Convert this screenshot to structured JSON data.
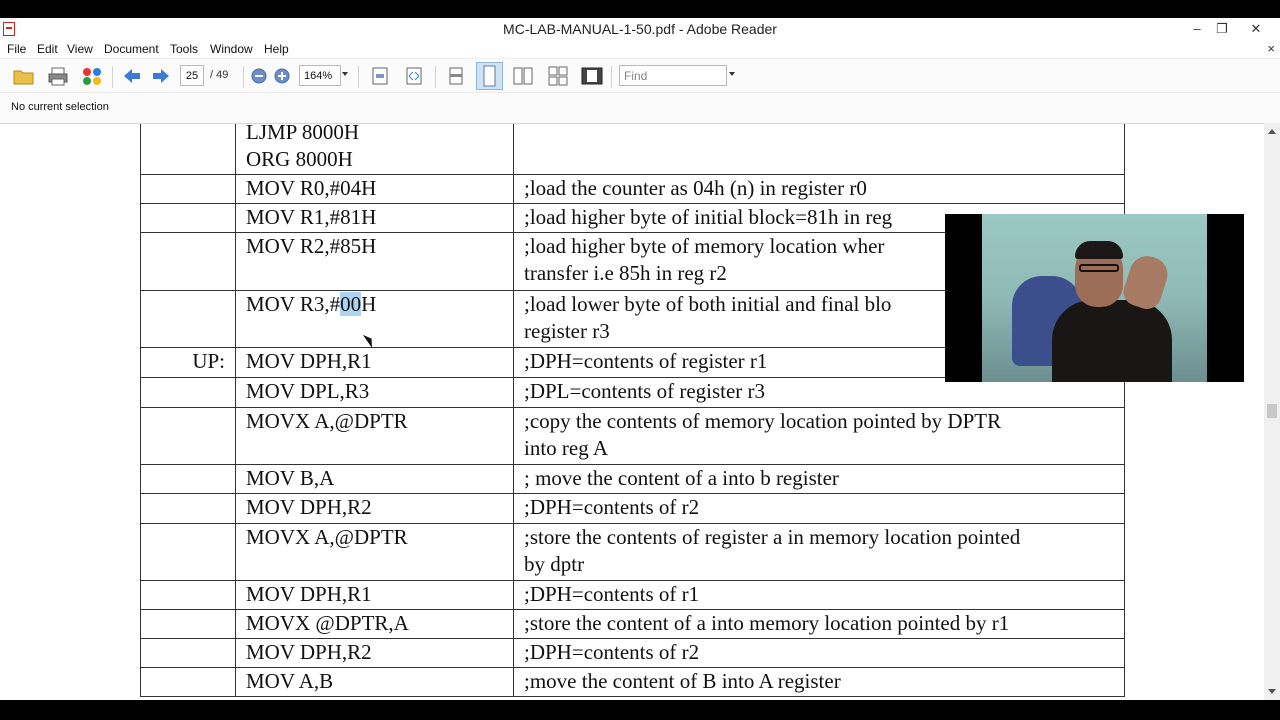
{
  "window": {
    "title": "MC-LAB-MANUAL-1-50.pdf - Adobe Reader",
    "minimize": "–",
    "restore": "❐",
    "close": "✕"
  },
  "menu": {
    "items": [
      "File",
      "Edit",
      "View",
      "Document",
      "Tools",
      "Window",
      "Help"
    ],
    "close": "×"
  },
  "toolbar": {
    "page_current": "25",
    "page_total": "/ 49",
    "zoom": "164%",
    "find_placeholder": "Find"
  },
  "status": {
    "selection_text": "No current selection"
  },
  "document": {
    "rows": [
      {
        "label": "",
        "instruction": [
          "LJMP 8000H",
          "ORG 8000H"
        ],
        "comment": [
          ""
        ]
      },
      {
        "label": "",
        "instruction": [
          "MOV R0,#04H"
        ],
        "comment": [
          ";load the counter as 04h (n) in register r0"
        ]
      },
      {
        "label": "",
        "instruction": [
          "MOV R1,#81H"
        ],
        "comment": [
          ";load higher byte of initial block=81h in reg"
        ]
      },
      {
        "label": "",
        "instruction": [
          "MOV R2,#85H"
        ],
        "comment": [
          ";load higher byte of memory location wher",
          "transfer i.e 85h in reg r2"
        ]
      },
      {
        "label": "",
        "instruction": [
          "MOV R3,#00H"
        ],
        "comment": [
          ";load lower byte of both initial and final blo",
          "register r3"
        ]
      },
      {
        "label": "UP:",
        "instruction": [
          "MOV DPH,R1"
        ],
        "comment": [
          ";DPH=contents of register r1"
        ]
      },
      {
        "label": "",
        "instruction": [
          "MOV DPL,R3"
        ],
        "comment": [
          ";DPL=contents of register r3"
        ]
      },
      {
        "label": "",
        "instruction": [
          "MOVX A,@DPTR"
        ],
        "comment": [
          ";copy the contents of memory location pointed by DPTR",
          "into reg A"
        ]
      },
      {
        "label": "",
        "instruction": [
          "MOV B,A"
        ],
        "comment": [
          "; move the content of a into b register"
        ]
      },
      {
        "label": "",
        "instruction": [
          "MOV DPH,R2"
        ],
        "comment": [
          ";DPH=contents of r2"
        ]
      },
      {
        "label": "",
        "instruction": [
          "MOVX A,@DPTR"
        ],
        "comment": [
          ";store the contents of register a in memory location pointed",
          "by dptr"
        ]
      },
      {
        "label": "",
        "instruction": [
          "MOV DPH,R1"
        ],
        "comment": [
          ";DPH=contents of r1"
        ]
      },
      {
        "label": "",
        "instruction": [
          "MOVX @DPTR,A"
        ],
        "comment": [
          ";store the content of a into memory location pointed by r1"
        ]
      },
      {
        "label": "",
        "instruction": [
          "MOV DPH,R2"
        ],
        "comment": [
          ";DPH=contents of r2"
        ]
      },
      {
        "label": "",
        "instruction": [
          "MOV A,B"
        ],
        "comment": [
          ";move the content of B into A register"
        ]
      }
    ]
  },
  "colors": {
    "highlight": "#aed3f0",
    "toolbar_bg": "#fbfbfb"
  },
  "icons": [
    "open-folder-icon",
    "print-icon",
    "collaborate-icon",
    "previous-page-icon",
    "next-page-icon",
    "zoom-out-icon",
    "zoom-in-icon",
    "fit-page-icon",
    "fit-width-icon",
    "single-page-icon",
    "continuous-icon",
    "two-page-icon",
    "two-page-continuous-icon",
    "read-mode-icon"
  ]
}
